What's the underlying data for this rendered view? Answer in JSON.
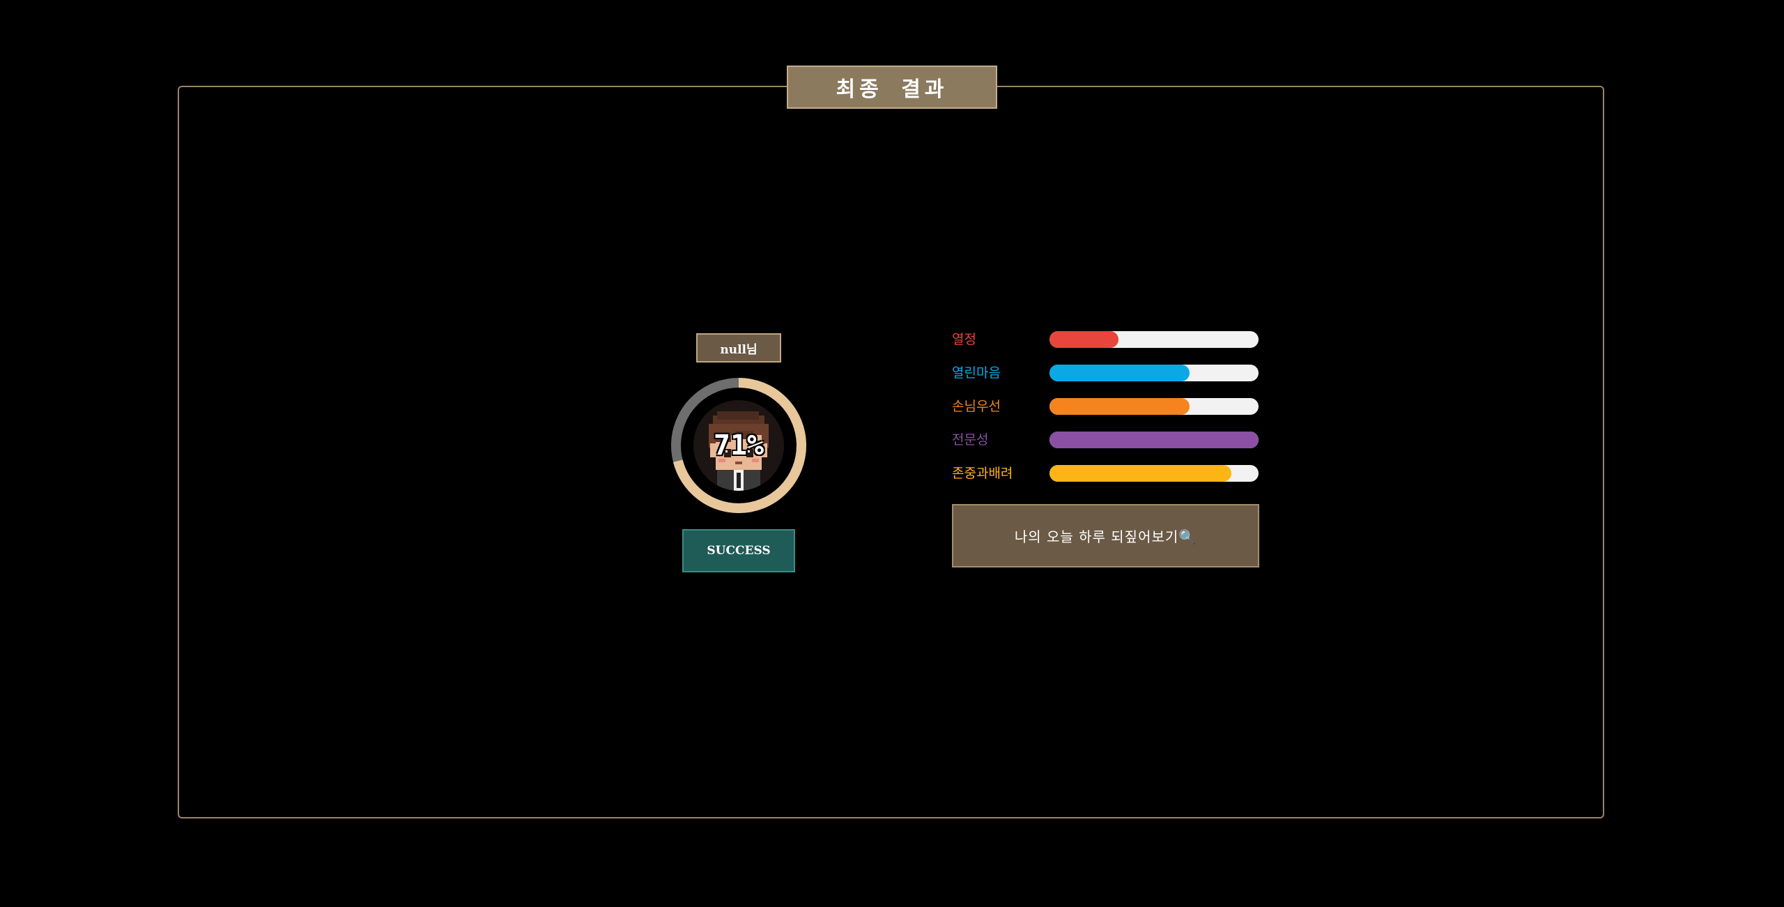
{
  "header": {
    "title": "최종 결과"
  },
  "player": {
    "name": "null님",
    "percent_label": "71%",
    "percent_value": 71,
    "status_label": "SUCCESS",
    "ring_color": "#e8c79b",
    "ring_track_color": "#6e6e6e"
  },
  "stats": [
    {
      "label": "열정",
      "value": 33,
      "color": "#e8453c"
    },
    {
      "label": "열린마음",
      "value": 67,
      "color": "#0aa9e6"
    },
    {
      "label": "손님우선",
      "value": 67,
      "color": "#f5841f"
    },
    {
      "label": "전문성",
      "value": 100,
      "color": "#8b4fa3"
    },
    {
      "label": "존중과배려",
      "value": 87,
      "color": "#fdb515"
    }
  ],
  "actions": {
    "reflect_label": "나의 오늘 하루 되짚어보기🔍"
  }
}
